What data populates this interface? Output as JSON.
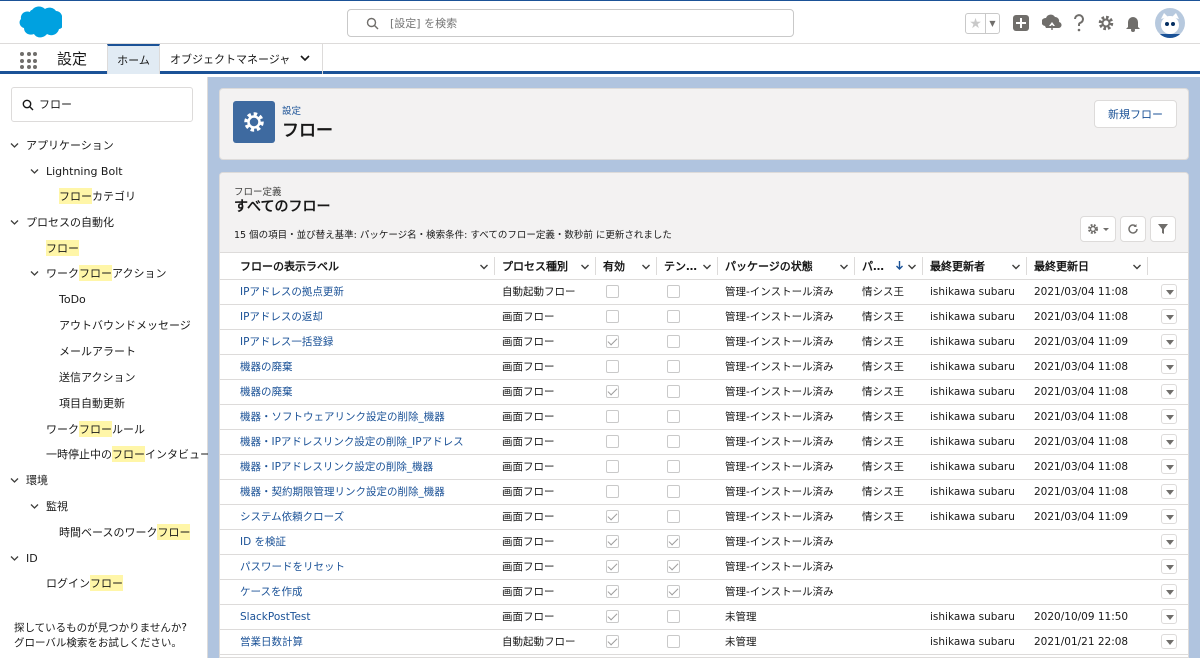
{
  "header": {
    "search_placeholder": "[設定] を検索",
    "icons": [
      "salesforce-cloud-logo",
      "search-icon",
      "star-icon",
      "chevron-down-icon",
      "add-icon",
      "trailhead-icon",
      "help-icon",
      "gear-icon",
      "bell-icon",
      "avatar"
    ]
  },
  "app_nav": {
    "app_name": "設定",
    "tabs": [
      "ホーム",
      "オブジェクトマネージャ"
    ]
  },
  "sidebar": {
    "quick_find_value": "フロー",
    "tree": [
      {
        "pre": "アプリケーション",
        "hl": "",
        "post": ""
      },
      {
        "pre": "Lightning Bolt",
        "hl": "",
        "post": ""
      },
      {
        "pre": "",
        "hl": "フロー",
        "post": "カテゴリ"
      },
      {
        "pre": "プロセスの自動化",
        "hl": "",
        "post": ""
      },
      {
        "pre": "",
        "hl": "フロー",
        "post": ""
      },
      {
        "pre": "ワーク",
        "hl": "フロー",
        "post": "アクション"
      },
      {
        "pre": "ToDo",
        "hl": "",
        "post": ""
      },
      {
        "pre": "アウトバウンドメッセージ",
        "hl": "",
        "post": ""
      },
      {
        "pre": "メールアラート",
        "hl": "",
        "post": ""
      },
      {
        "pre": "送信アクション",
        "hl": "",
        "post": ""
      },
      {
        "pre": "項目自動更新",
        "hl": "",
        "post": ""
      },
      {
        "pre": "ワーク",
        "hl": "フロー",
        "post": "ルール"
      },
      {
        "pre": "一時停止中の",
        "hl": "フロー",
        "post": "インタビュー"
      },
      {
        "pre": "環境",
        "hl": "",
        "post": ""
      },
      {
        "pre": "監視",
        "hl": "",
        "post": ""
      },
      {
        "pre": "時間ベースのワーク",
        "hl": "フロー",
        "post": ""
      },
      {
        "pre": "ID",
        "hl": "",
        "post": ""
      },
      {
        "pre": "ログイン",
        "hl": "フロー",
        "post": ""
      }
    ],
    "help_line1": "探しているものが見つかりませんか?",
    "help_line2": "グローバル検索をお試しください。"
  },
  "page_header": {
    "breadcrumb": "設定",
    "title": "フロー",
    "new_button": "新規フロー"
  },
  "list": {
    "object_label": "フロー定義",
    "view_name": "すべてのフロー",
    "meta": "15 個の項目・並び替え基準: パッケージ名・検索条件: すべてのフロー定義・数秒前 に更新されました",
    "columns": [
      "フローの表示ラベル",
      "プロセス種別",
      "有効",
      "テン…",
      "パッケージの状態",
      "パ…",
      "最終更新者",
      "最終更新日"
    ],
    "sort_indicator": "arrow-down-icon",
    "rows": [
      {
        "label": "IPアドレスの拠点更新",
        "type": "自動起動フロー",
        "active": false,
        "tmpl": false,
        "pkg": "管理-インストール済み",
        "ns": "情シス王",
        "by": "ishikawa subaru",
        "date": "2021/03/04 11:08"
      },
      {
        "label": "IPアドレスの返却",
        "type": "画面フロー",
        "active": false,
        "tmpl": false,
        "pkg": "管理-インストール済み",
        "ns": "情シス王",
        "by": "ishikawa subaru",
        "date": "2021/03/04 11:08"
      },
      {
        "label": "IPアドレス一括登録",
        "type": "画面フロー",
        "active": true,
        "tmpl": false,
        "pkg": "管理-インストール済み",
        "ns": "情シス王",
        "by": "ishikawa subaru",
        "date": "2021/03/04 11:09"
      },
      {
        "label": "機器の廃棄",
        "type": "画面フロー",
        "active": false,
        "tmpl": false,
        "pkg": "管理-インストール済み",
        "ns": "情シス王",
        "by": "ishikawa subaru",
        "date": "2021/03/04 11:08"
      },
      {
        "label": "機器の廃棄",
        "type": "画面フロー",
        "active": true,
        "tmpl": false,
        "pkg": "管理-インストール済み",
        "ns": "情シス王",
        "by": "ishikawa subaru",
        "date": "2021/03/04 11:08"
      },
      {
        "label": "機器・ソフトウェアリンク設定の削除_機器",
        "type": "画面フロー",
        "active": false,
        "tmpl": false,
        "pkg": "管理-インストール済み",
        "ns": "情シス王",
        "by": "ishikawa subaru",
        "date": "2021/03/04 11:08"
      },
      {
        "label": "機器・IPアドレスリンク設定の削除_IPアドレス",
        "type": "画面フロー",
        "active": false,
        "tmpl": false,
        "pkg": "管理-インストール済み",
        "ns": "情シス王",
        "by": "ishikawa subaru",
        "date": "2021/03/04 11:08"
      },
      {
        "label": "機器・IPアドレスリンク設定の削除_機器",
        "type": "画面フロー",
        "active": false,
        "tmpl": false,
        "pkg": "管理-インストール済み",
        "ns": "情シス王",
        "by": "ishikawa subaru",
        "date": "2021/03/04 11:08"
      },
      {
        "label": "機器・契約期限管理リンク設定の削除_機器",
        "type": "画面フロー",
        "active": false,
        "tmpl": false,
        "pkg": "管理-インストール済み",
        "ns": "情シス王",
        "by": "ishikawa subaru",
        "date": "2021/03/04 11:08"
      },
      {
        "label": "システム依頼クローズ",
        "type": "画面フロー",
        "active": true,
        "tmpl": false,
        "pkg": "管理-インストール済み",
        "ns": "情シス王",
        "by": "ishikawa subaru",
        "date": "2021/03/04 11:09"
      },
      {
        "label": "ID を検証",
        "type": "画面フロー",
        "active": true,
        "tmpl": true,
        "pkg": "管理-インストール済み",
        "ns": "",
        "by": "",
        "date": ""
      },
      {
        "label": "パスワードをリセット",
        "type": "画面フロー",
        "active": true,
        "tmpl": true,
        "pkg": "管理-インストール済み",
        "ns": "",
        "by": "",
        "date": ""
      },
      {
        "label": "ケースを作成",
        "type": "画面フロー",
        "active": true,
        "tmpl": true,
        "pkg": "管理-インストール済み",
        "ns": "",
        "by": "",
        "date": ""
      },
      {
        "label": "SlackPostTest",
        "type": "画面フロー",
        "active": true,
        "tmpl": false,
        "pkg": "未管理",
        "ns": "",
        "by": "ishikawa subaru",
        "date": "2020/10/09 11:50"
      },
      {
        "label": "営業日数計算",
        "type": "自動起動フロー",
        "active": true,
        "tmpl": false,
        "pkg": "未管理",
        "ns": "",
        "by": "ishikawa subaru",
        "date": "2021/01/21 22:08"
      }
    ]
  },
  "colors": {
    "brand": "#1b5297",
    "background": "#b0c4df",
    "highlight": "#fff6a8",
    "icon_tile": "#3e6aa0"
  }
}
